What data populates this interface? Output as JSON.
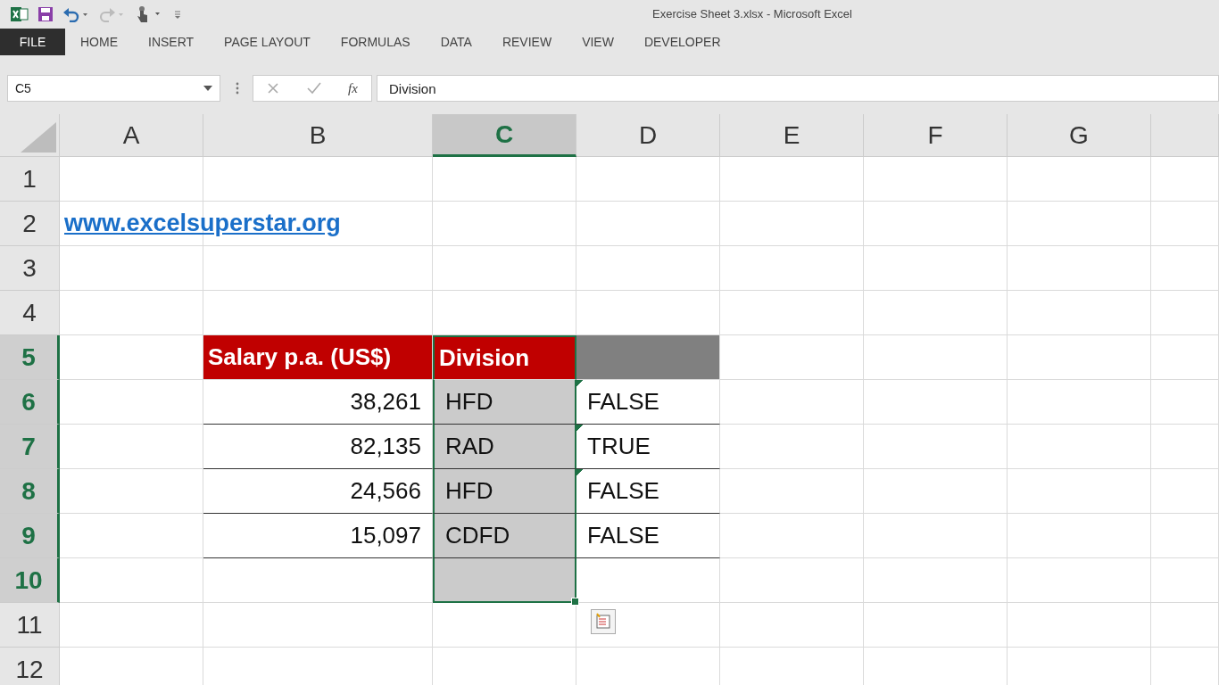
{
  "window": {
    "title": "Exercise Sheet 3.xlsx - Microsoft Excel"
  },
  "ribbon_tabs": [
    {
      "label": "FILE",
      "kind": "file"
    },
    {
      "label": "HOME",
      "kind": "tab"
    },
    {
      "label": "INSERT",
      "kind": "tab"
    },
    {
      "label": "PAGE LAYOUT",
      "kind": "tab"
    },
    {
      "label": "FORMULAS",
      "kind": "tab"
    },
    {
      "label": "DATA",
      "kind": "tab"
    },
    {
      "label": "REVIEW",
      "kind": "tab"
    },
    {
      "label": "VIEW",
      "kind": "tab"
    },
    {
      "label": "DEVELOPER",
      "kind": "tab"
    }
  ],
  "formula_bar": {
    "name_box": "C5",
    "function_label": "fx",
    "formula": "Division"
  },
  "columns": [
    {
      "label": "A",
      "selected": false
    },
    {
      "label": "B",
      "selected": false
    },
    {
      "label": "C",
      "selected": true
    },
    {
      "label": "D",
      "selected": false
    },
    {
      "label": "E",
      "selected": false
    },
    {
      "label": "F",
      "selected": false
    },
    {
      "label": "G",
      "selected": false
    }
  ],
  "rows": [
    {
      "label": "1",
      "selected": false,
      "cells": [
        {
          "kind": "empty",
          "selected": false
        },
        {
          "kind": "empty",
          "selected": false
        },
        {
          "kind": "empty",
          "selected": false
        },
        {
          "kind": "empty",
          "selected": false
        },
        {
          "kind": "empty",
          "selected": false
        },
        {
          "kind": "empty",
          "selected": false
        },
        {
          "kind": "empty",
          "selected": false
        }
      ]
    },
    {
      "label": "2",
      "selected": false,
      "cells": [
        {
          "kind": "link",
          "text": "www.excelsuperstar.org",
          "selected": false
        },
        {
          "kind": "empty",
          "selected": false
        },
        {
          "kind": "empty",
          "selected": false
        },
        {
          "kind": "empty",
          "selected": false
        },
        {
          "kind": "empty",
          "selected": false
        },
        {
          "kind": "empty",
          "selected": false
        },
        {
          "kind": "empty",
          "selected": false
        }
      ]
    },
    {
      "label": "3",
      "selected": false,
      "cells": [
        {
          "kind": "empty",
          "selected": false
        },
        {
          "kind": "empty",
          "selected": false
        },
        {
          "kind": "empty",
          "selected": false
        },
        {
          "kind": "empty",
          "selected": false
        },
        {
          "kind": "empty",
          "selected": false
        },
        {
          "kind": "empty",
          "selected": false
        },
        {
          "kind": "empty",
          "selected": false
        }
      ]
    },
    {
      "label": "4",
      "selected": false,
      "cells": [
        {
          "kind": "empty",
          "selected": false
        },
        {
          "kind": "empty",
          "selected": false
        },
        {
          "kind": "empty",
          "selected": false
        },
        {
          "kind": "empty",
          "selected": false
        },
        {
          "kind": "empty",
          "selected": false
        },
        {
          "kind": "empty",
          "selected": false
        },
        {
          "kind": "empty",
          "selected": false
        }
      ]
    },
    {
      "label": "5",
      "selected": true,
      "cells": [
        {
          "kind": "empty",
          "selected": false
        },
        {
          "kind": "header",
          "text": "Salary p.a. (US$)",
          "selected": false
        },
        {
          "kind": "header",
          "text": "Division",
          "selected": true
        },
        {
          "kind": "header_blank",
          "selected": false
        },
        {
          "kind": "empty",
          "selected": false
        },
        {
          "kind": "empty",
          "selected": false
        },
        {
          "kind": "empty",
          "selected": false
        }
      ]
    },
    {
      "label": "6",
      "selected": true,
      "cells": [
        {
          "kind": "empty",
          "selected": false
        },
        {
          "kind": "number",
          "text": "38,261",
          "selected": false
        },
        {
          "kind": "text",
          "text": "HFD",
          "selected": true
        },
        {
          "kind": "flagged",
          "text": "FALSE",
          "selected": false
        },
        {
          "kind": "empty",
          "selected": false
        },
        {
          "kind": "empty",
          "selected": false
        },
        {
          "kind": "empty",
          "selected": false
        }
      ]
    },
    {
      "label": "7",
      "selected": true,
      "cells": [
        {
          "kind": "empty",
          "selected": false
        },
        {
          "kind": "number",
          "text": "82,135",
          "selected": false
        },
        {
          "kind": "text",
          "text": "RAD",
          "selected": true
        },
        {
          "kind": "flagged",
          "text": "TRUE",
          "selected": false
        },
        {
          "kind": "empty",
          "selected": false
        },
        {
          "kind": "empty",
          "selected": false
        },
        {
          "kind": "empty",
          "selected": false
        }
      ]
    },
    {
      "label": "8",
      "selected": true,
      "cells": [
        {
          "kind": "empty",
          "selected": false
        },
        {
          "kind": "number",
          "text": "24,566",
          "selected": false
        },
        {
          "kind": "text",
          "text": "HFD",
          "selected": true
        },
        {
          "kind": "flagged",
          "text": "FALSE",
          "selected": false
        },
        {
          "kind": "empty",
          "selected": false
        },
        {
          "kind": "empty",
          "selected": false
        },
        {
          "kind": "empty",
          "selected": false
        }
      ]
    },
    {
      "label": "9",
      "selected": true,
      "cells": [
        {
          "kind": "empty",
          "selected": false
        },
        {
          "kind": "number",
          "text": "15,097",
          "selected": false
        },
        {
          "kind": "text",
          "text": "CDFD",
          "selected": true
        },
        {
          "kind": "text",
          "text": "FALSE",
          "selected": false
        },
        {
          "kind": "empty",
          "selected": false
        },
        {
          "kind": "empty",
          "selected": false
        },
        {
          "kind": "empty",
          "selected": false
        }
      ]
    },
    {
      "label": "10",
      "selected": true,
      "cells": [
        {
          "kind": "empty",
          "selected": false
        },
        {
          "kind": "empty",
          "selected": false
        },
        {
          "kind": "empty",
          "selected": true
        },
        {
          "kind": "empty",
          "selected": false
        },
        {
          "kind": "empty",
          "selected": false
        },
        {
          "kind": "empty",
          "selected": false
        },
        {
          "kind": "empty",
          "selected": false
        }
      ]
    },
    {
      "label": "11",
      "selected": false,
      "cells": [
        {
          "kind": "empty",
          "selected": false
        },
        {
          "kind": "empty",
          "selected": false
        },
        {
          "kind": "empty",
          "selected": false
        },
        {
          "kind": "empty",
          "selected": false
        },
        {
          "kind": "empty",
          "selected": false
        },
        {
          "kind": "empty",
          "selected": false
        },
        {
          "kind": "empty",
          "selected": false
        }
      ]
    },
    {
      "label": "12",
      "selected": false,
      "cells": [
        {
          "kind": "empty",
          "selected": false
        },
        {
          "kind": "empty",
          "selected": false
        },
        {
          "kind": "empty",
          "selected": false
        },
        {
          "kind": "empty",
          "selected": false
        },
        {
          "kind": "empty",
          "selected": false
        },
        {
          "kind": "empty",
          "selected": false
        },
        {
          "kind": "empty",
          "selected": false
        }
      ]
    }
  ]
}
